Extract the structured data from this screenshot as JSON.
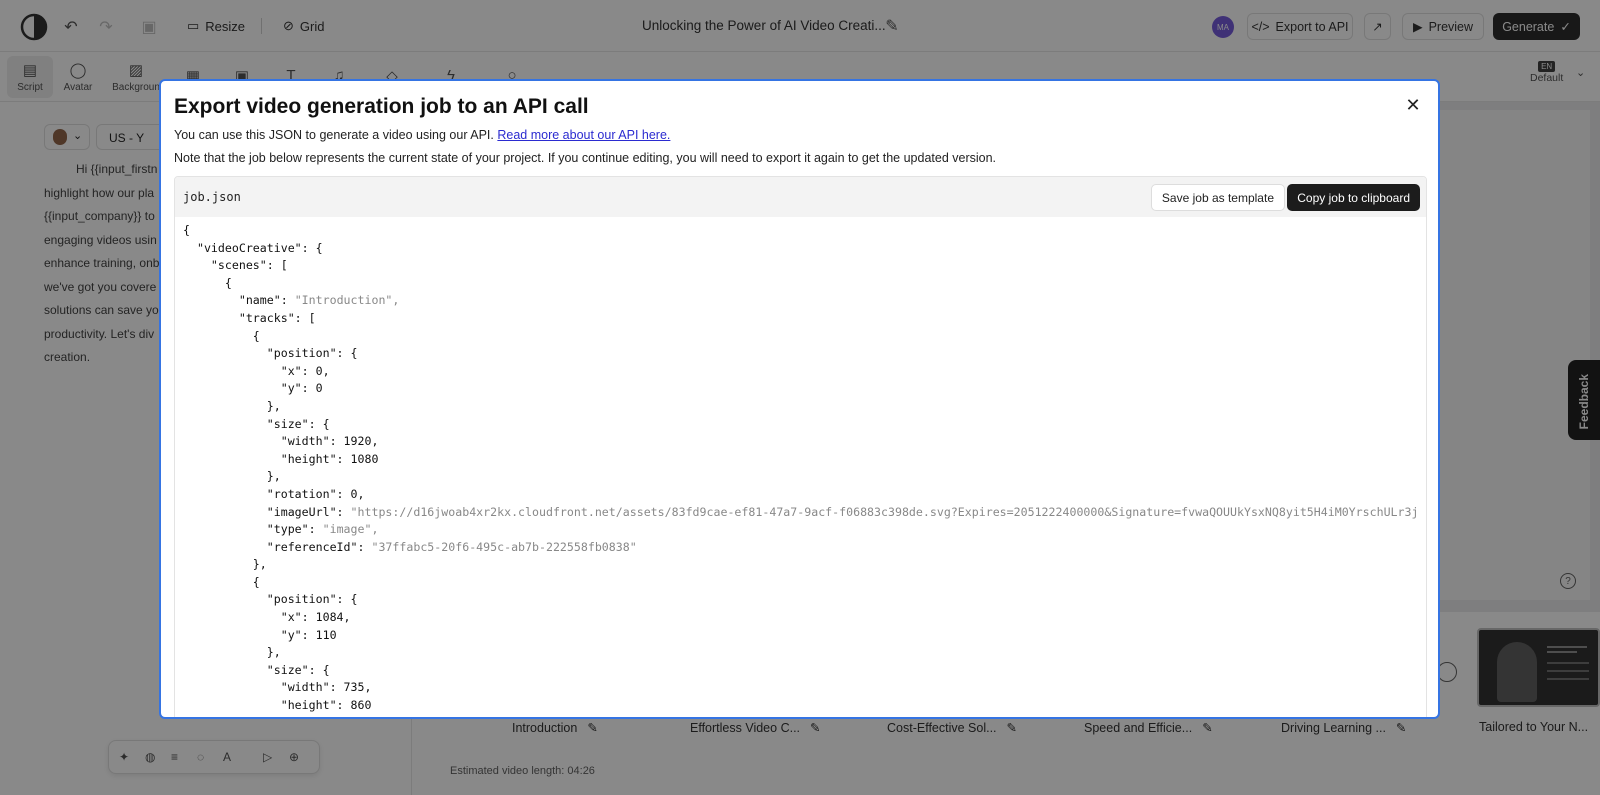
{
  "topbar": {
    "resize_label": "Resize",
    "grid_label": "Grid",
    "project_title": "Unlocking the Power of AI Video Creati...",
    "avatar_initials": "MA",
    "export_label": "Export to API",
    "preview_label": "Preview",
    "generate_label": "Generate"
  },
  "toolbar": {
    "script_label": "Script",
    "avatar_label": "Avatar",
    "background_label": "Backgroun",
    "language_badge": "EN",
    "language_label": "Default"
  },
  "script": {
    "voice_label": "US - Y",
    "text_lines": [
      "Hi {{input_firstn",
      "highlight how our pla",
      "{{input_company}} to",
      "engaging videos usin",
      "enhance training, onb",
      "we've got you covere",
      "solutions can save yo",
      "productivity. Let's div",
      "creation."
    ]
  },
  "scenes": [
    {
      "label": "Introduction"
    },
    {
      "label": "Effortless Video C..."
    },
    {
      "label": "Cost-Effective Sol..."
    },
    {
      "label": "Speed and Efficie..."
    },
    {
      "label": "Driving Learning ..."
    }
  ],
  "thumb_label": "Tailored to Your N...",
  "estimated_length": "Estimated video length: 04:26",
  "feedback_label": "Feedback",
  "modal": {
    "title": "Export video generation job to an API call",
    "intro_text": "You can use this JSON to generate a video using our API.",
    "intro_link": "Read more about our API here.",
    "note": "Note that the job below represents the current state of your project. If you continue editing, you will need to export it again to get the updated version.",
    "filename": "job.json",
    "save_template_label": "Save job as template",
    "copy_label": "Copy job to clipboard",
    "code_lines": [
      "{",
      "  \"videoCreative\": {",
      "    \"scenes\": [",
      "      {",
      "        \"name\": \"Introduction\",",
      "        \"tracks\": [",
      "          {",
      "            \"position\": {",
      "              \"x\": 0,",
      "              \"y\": 0",
      "            },",
      "            \"size\": {",
      "              \"width\": 1920,",
      "              \"height\": 1080",
      "            },",
      "            \"rotation\": 0,",
      "            \"imageUrl\": \"https://d16jwoab4xr2kx.cloudfront.net/assets/83fd9cae-ef81-47a7-9acf-f06883c398de.svg?Expires=2051222400000&Signature=fvwaQOUUkYsxNQ8yit5H4iM0YrschULr3j",
      "            \"type\": \"image\",",
      "            \"referenceId\": \"37ffabc5-20f6-495c-ab7b-222558fb0838\"",
      "          },",
      "          {",
      "            \"position\": {",
      "              \"x\": 1084,",
      "              \"y\": 110",
      "            },",
      "            \"size\": {",
      "              \"width\": 735,",
      "              \"height\": 860",
      "            },"
    ]
  }
}
